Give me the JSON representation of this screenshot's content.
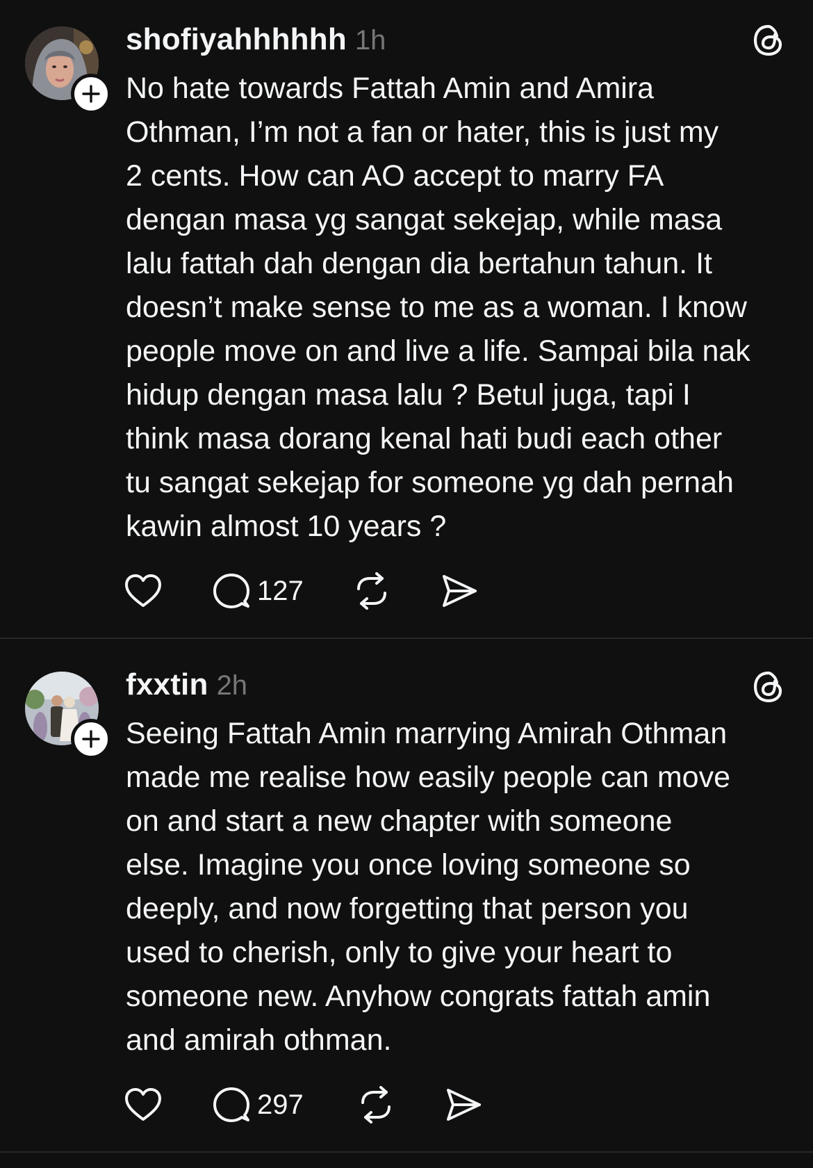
{
  "colors": {
    "background": "#101010",
    "text": "#f3f5f7",
    "muted": "#777777",
    "divider": "#2a2a2a"
  },
  "posts": [
    {
      "username": "shofiyahhhhhh",
      "time": "1h",
      "avatar_icon": "user-avatar-hijab",
      "follow_icon": "plus-icon",
      "app_icon": "threads-logo-icon",
      "lines": [
        "No hate towards Fattah Amin and Amira",
        "Othman, I’m not a fan or hater, this is just my",
        "2 cents. How can AO accept to marry FA",
        "dengan masa yg sangat sekejap, while masa",
        "lalu fattah dah dengan dia bertahun tahun. It",
        "doesn’t make sense to me as a woman. I know",
        "people move on and live a life. Sampai bila nak",
        "hidup dengan masa lalu ? Betul juga, tapi I",
        "think masa dorang kenal hati budi each other",
        "tu sangat sekejap for someone yg dah pernah",
        "kawin almost 10 years ?"
      ],
      "actions": {
        "like_icon": "heart-icon",
        "reply_icon": "reply-bubble-icon",
        "reply_count": "127",
        "repost_icon": "repost-icon",
        "share_icon": "send-icon"
      }
    },
    {
      "username": "fxxtin",
      "time": "2h",
      "avatar_icon": "user-avatar-wedding",
      "follow_icon": "plus-icon",
      "app_icon": "threads-logo-icon",
      "lines": [
        "Seeing Fattah Amin marrying Amirah Othman",
        "made me realise how easily people can move",
        "on and start a new chapter with someone",
        "else. Imagine you once loving someone so",
        "deeply, and now forgetting that person you",
        "used to cherish, only to give your heart to",
        "someone new. Anyhow congrats fattah amin",
        "and amirah othman."
      ],
      "actions": {
        "like_icon": "heart-icon",
        "reply_icon": "reply-bubble-icon",
        "reply_count": "297",
        "repost_icon": "repost-icon",
        "share_icon": "send-icon"
      }
    }
  ]
}
